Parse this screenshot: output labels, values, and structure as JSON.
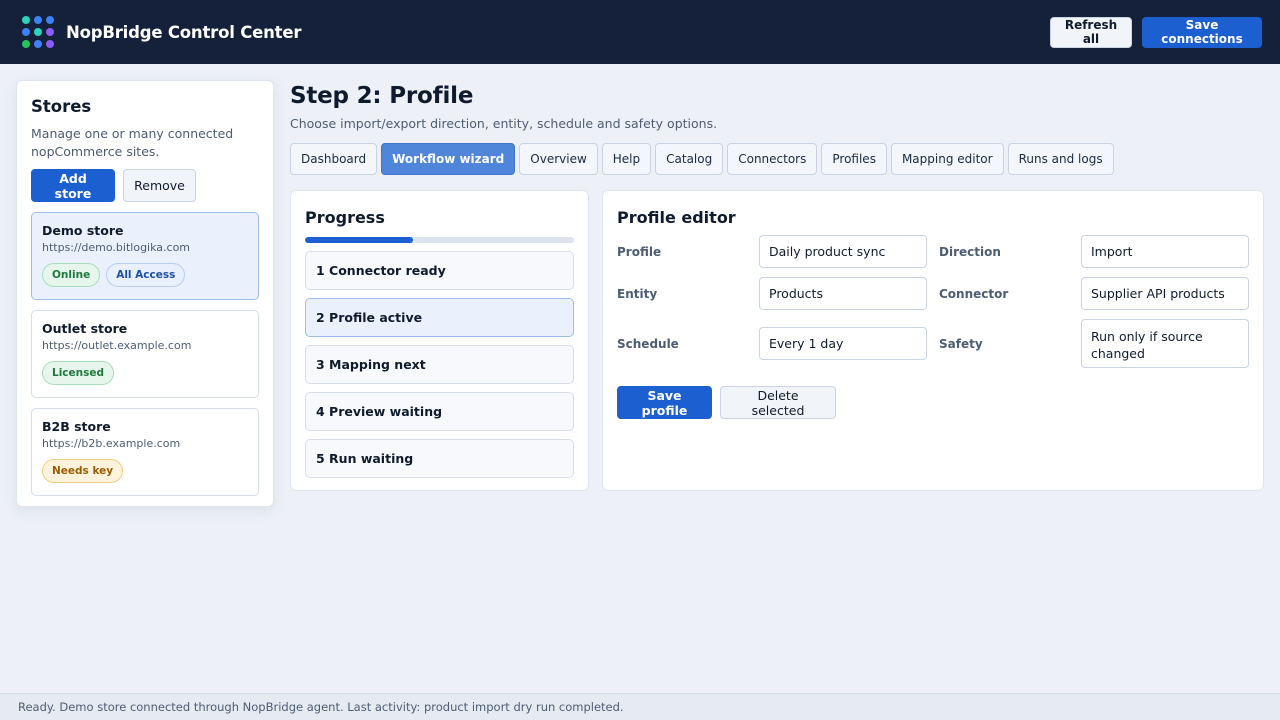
{
  "header": {
    "title": "NopBridge Control Center",
    "refresh_label": "Refresh all",
    "save_label": "Save connections",
    "logo_colors": [
      "#2dd4bf",
      "#3b82f6",
      "#8b5cf6",
      "#22c55e"
    ]
  },
  "sidebar": {
    "title": "Stores",
    "description": "Manage one or many connected nopCommerce sites.",
    "add_label": "Add store",
    "remove_label": "Remove",
    "stores": [
      {
        "name": "Demo store",
        "url": "https://demo.bitlogika.com",
        "badges": [
          "Online",
          "All Access"
        ],
        "active": true
      },
      {
        "name": "Outlet store",
        "url": "https://outlet.example.com",
        "badges": [
          "Licensed"
        ],
        "active": false
      },
      {
        "name": "B2B store",
        "url": "https://b2b.example.com",
        "badges": [
          "Needs key"
        ],
        "active": false
      }
    ]
  },
  "main": {
    "title": "Step 2: Profile",
    "subtitle": "Choose import/export direction, entity, schedule and safety options.",
    "tabs": [
      "Dashboard",
      "Workflow wizard",
      "Overview",
      "Help",
      "Catalog",
      "Connectors",
      "Profiles",
      "Mapping editor",
      "Runs and logs"
    ],
    "active_tab": "Workflow wizard"
  },
  "progress": {
    "title": "Progress",
    "fraction": 0.4,
    "steps": [
      "1 Connector ready",
      "2 Profile active",
      "3 Mapping next",
      "4 Preview waiting",
      "5 Run waiting"
    ],
    "active_step": 1
  },
  "editor": {
    "title": "Profile editor",
    "labels": {
      "profile": "Profile",
      "direction": "Direction",
      "entity": "Entity",
      "connector": "Connector",
      "schedule": "Schedule",
      "safety": "Safety"
    },
    "values": {
      "profile": "Daily product sync",
      "direction": "Import",
      "entity": "Products",
      "connector": "Supplier API products",
      "schedule": "Every 1 day",
      "safety": "Run only if source changed"
    },
    "save_label": "Save profile",
    "delete_label": "Delete selected"
  },
  "status": {
    "text": "Ready. Demo store connected through NopBridge agent. Last activity: product import dry run completed."
  }
}
